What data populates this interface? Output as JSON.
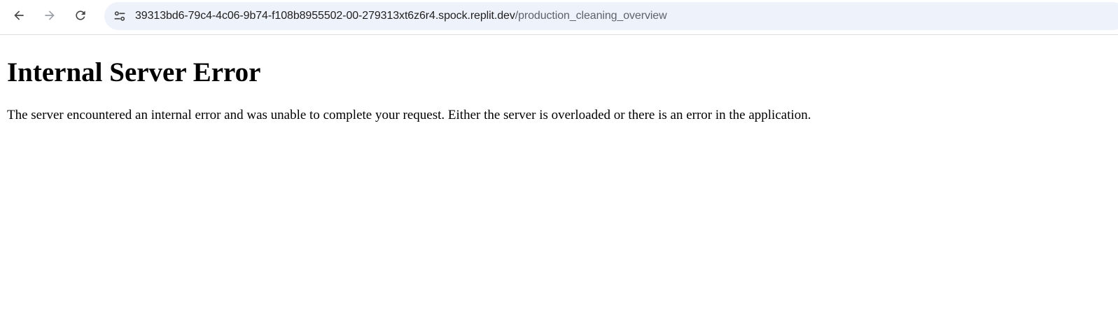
{
  "browser": {
    "nav": {
      "back_icon": "arrow-left-icon",
      "forward_icon": "arrow-right-icon",
      "reload_icon": "reload-icon"
    },
    "address_bar": {
      "site_info_icon": "tune-icon",
      "url_host": "39313bd6-79c4-4c06-9b74-f108b8955502-00-279313xt6z6r4.spock.replit.dev",
      "url_path": "/production_cleaning_overview"
    },
    "colors": {
      "omnibox_bg": "#eef2fb",
      "url_host_color": "#1f1f1f",
      "url_path_color": "#5f6368",
      "icon_color": "#474747",
      "forward_disabled_color": "#9aa0a6"
    }
  },
  "page": {
    "heading": "Internal Server Error",
    "message": "The server encountered an internal error and was unable to complete your request. Either the server is overloaded or there is an error in the application."
  }
}
